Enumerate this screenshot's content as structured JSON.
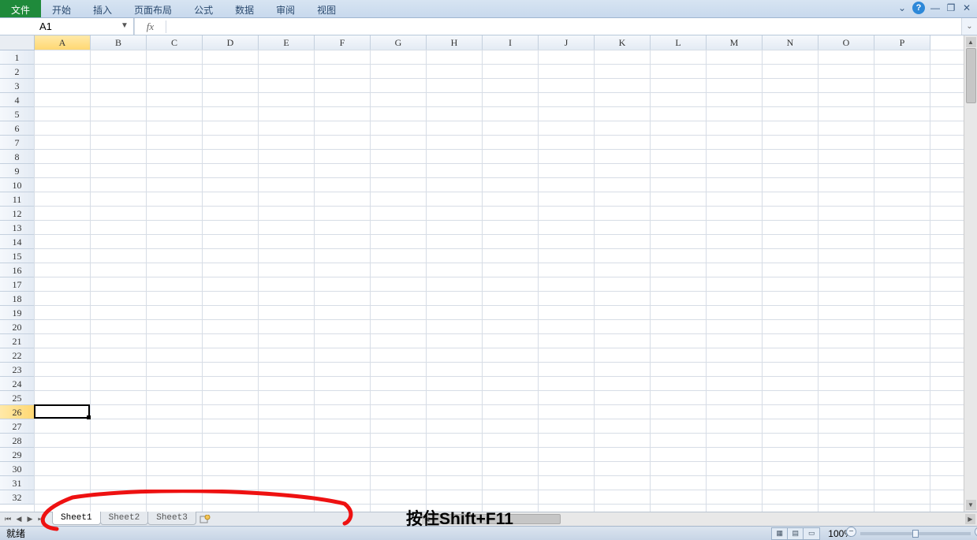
{
  "ribbon": {
    "tabs": [
      "文件",
      "开始",
      "插入",
      "页面布局",
      "公式",
      "数据",
      "审阅",
      "视图"
    ],
    "file_index": 0
  },
  "namebox": {
    "value": "A1"
  },
  "formula": {
    "fx": "fx",
    "value": ""
  },
  "columns": [
    "A",
    "B",
    "C",
    "D",
    "E",
    "F",
    "G",
    "H",
    "I",
    "J",
    "K",
    "L",
    "M",
    "N",
    "O",
    "P"
  ],
  "rows": [
    "1",
    "2",
    "3",
    "4",
    "5",
    "6",
    "7",
    "8",
    "9",
    "10",
    "11",
    "12",
    "13",
    "14",
    "15",
    "16",
    "17",
    "18",
    "19",
    "20",
    "21",
    "22",
    "23",
    "24",
    "25",
    "26",
    "27",
    "28",
    "29",
    "30",
    "31",
    "32"
  ],
  "selected_col_index": 0,
  "selected_row_index": 25,
  "sheets": {
    "tabs": [
      "Sheet1",
      "Sheet2",
      "Sheet3"
    ],
    "active_index": 0
  },
  "status": {
    "ready": "就绪",
    "zoom": "100%"
  },
  "annotation": {
    "text": "按住Shift+F11"
  }
}
